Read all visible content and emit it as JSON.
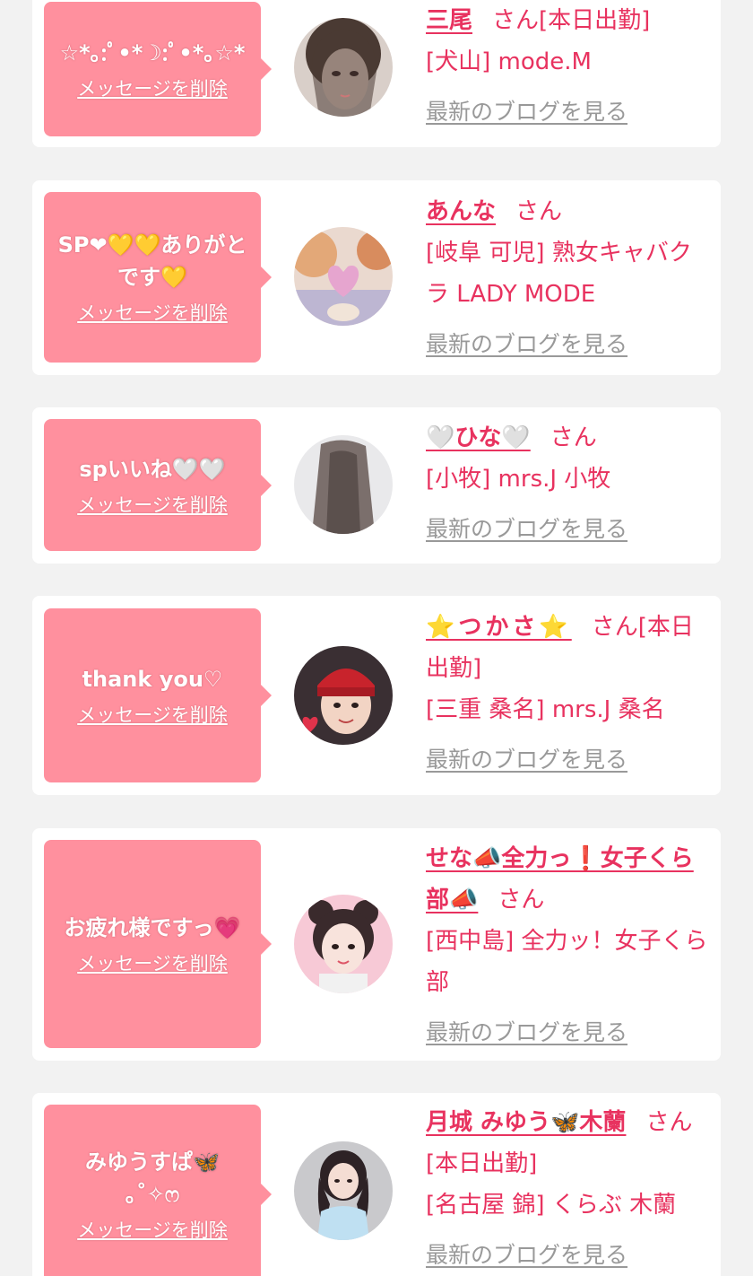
{
  "cards": [
    {
      "message": "☆*｡:ﾟ•*☽:ﾟ•*｡☆*",
      "delete_label": "メッセージを削除",
      "name": "三尾",
      "suffix": "さん[本日出勤]",
      "shop": "[犬山] mode.M",
      "blog_label": "最新のブログを見る"
    },
    {
      "message": "SP❤💛💛ありがとです💛",
      "delete_label": "メッセージを削除",
      "name": "あんな",
      "suffix": "さん",
      "shop": "[岐阜 可児] 熟女キャバクラ LADY MODE",
      "blog_label": "最新のブログを見る"
    },
    {
      "message": "spいいね🤍🤍",
      "delete_label": "メッセージを削除",
      "name": "🤍ひな🤍",
      "suffix": "さん",
      "shop": "[小牧] mrs.J 小牧",
      "blog_label": "最新のブログを見る"
    },
    {
      "message": "thank you♡",
      "delete_label": "メッセージを削除",
      "name": "⭐つかさ⭐",
      "suffix": "さん[本日出勤]",
      "shop": "[三重 桑名] mrs.J 桑名",
      "blog_label": "最新のブログを見る"
    },
    {
      "message": "お疲れ様ですっ💗",
      "delete_label": "メッセージを削除",
      "name": "せな📣全力っ❗女子くら部📣",
      "suffix": "さん",
      "shop": "[西中島] 全力ッ！女子くら部",
      "blog_label": "最新のブログを見る"
    },
    {
      "message": "みゆうすぱ🦋\n｡˚✧ෆ",
      "delete_label": "メッセージを削除",
      "name": "月城 みゆう🦋木蘭",
      "suffix": "さん[本日出勤]",
      "shop": "[名古屋 錦] くらぶ 木蘭",
      "blog_label": "最新のブログを見る"
    }
  ],
  "colors": {
    "page_bg": "#f2f2f2",
    "card_bg": "#ffffff",
    "bubble_bg": "#ff909e",
    "accent": "#e8325f",
    "link_gray": "#999999"
  }
}
